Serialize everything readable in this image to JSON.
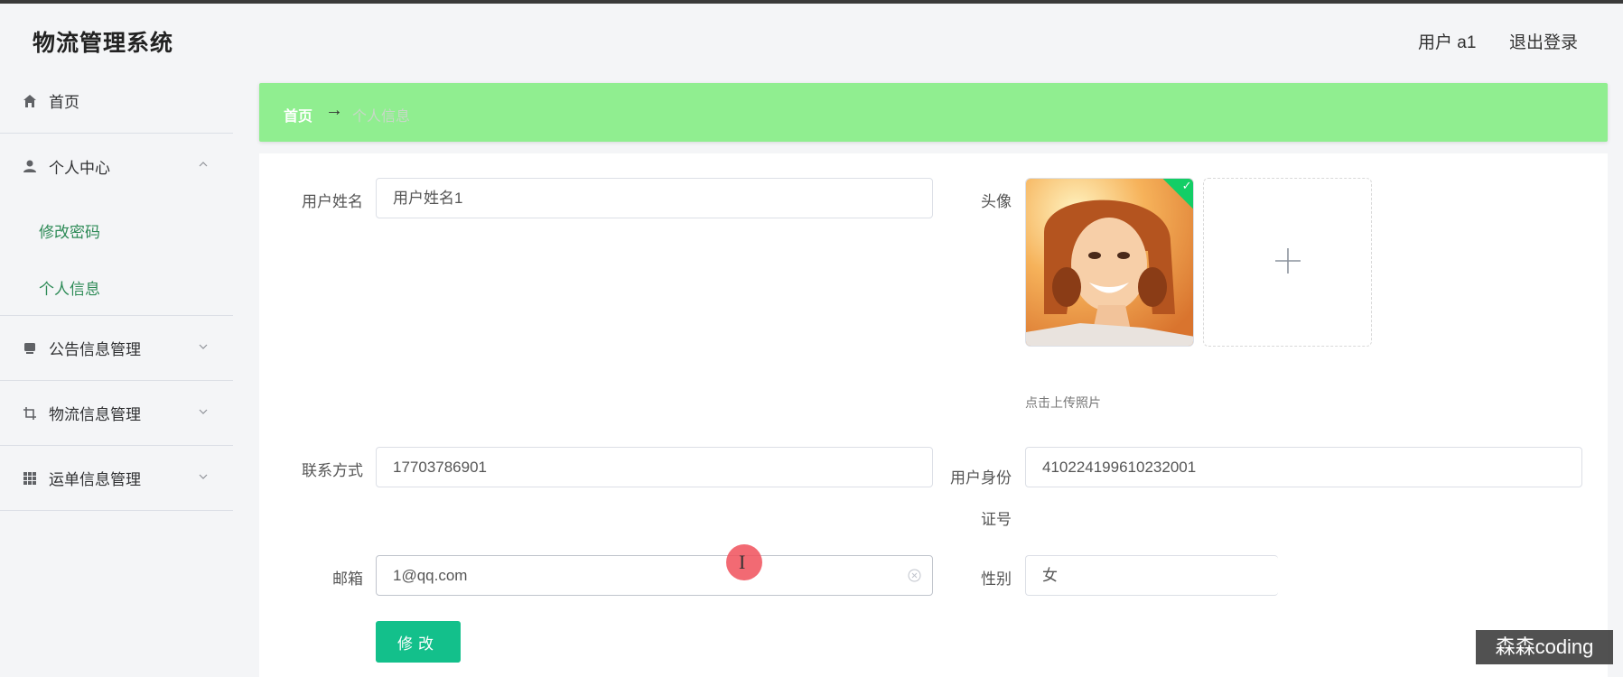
{
  "header": {
    "brand": "物流管理系统",
    "user_label": "用户 a1",
    "logout": "退出登录"
  },
  "sidebar": {
    "items": [
      {
        "label": "首页",
        "icon": "home-icon"
      },
      {
        "label": "个人中心",
        "icon": "user-icon",
        "expanded": true
      },
      {
        "label": "公告信息管理",
        "icon": "notice-icon"
      },
      {
        "label": "物流信息管理",
        "icon": "crop-icon"
      },
      {
        "label": "运单信息管理",
        "icon": "grid-icon"
      }
    ],
    "submenu": [
      {
        "label": "修改密码"
      },
      {
        "label": "个人信息"
      }
    ]
  },
  "breadcrumb": {
    "home": "首页",
    "arrow": "→",
    "current": "个人信息"
  },
  "form": {
    "username_label": "用户姓名",
    "username_value": "用户姓名1",
    "avatar_label": "头像",
    "upload_hint": "点击上传照片",
    "phone_label": "联系方式",
    "phone_value": "17703786901",
    "idcard_label": "用户身份证号",
    "idcard_value": "410224199610232001",
    "email_label": "邮箱",
    "email_value": "1@qq.com",
    "gender_label": "性别",
    "gender_value": "女",
    "submit_label": "修改"
  },
  "watermark": "森森coding",
  "colors": {
    "accent": "#13c08b",
    "breadcrumb_bg": "#90ee90",
    "submenu_text": "#2e8b57"
  }
}
